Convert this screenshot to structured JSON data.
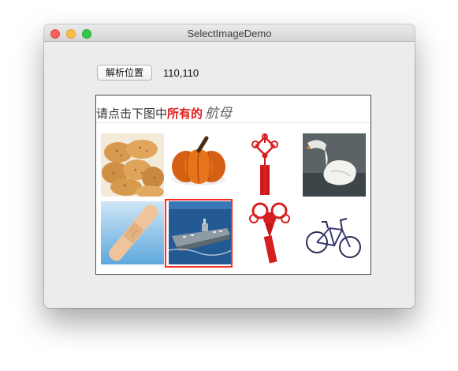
{
  "window": {
    "title": "SelectImageDemo"
  },
  "controls": {
    "parse_button_label": "解析位置",
    "position_value": "110,110"
  },
  "captcha": {
    "prompt_prefix": "请点击下图中",
    "prompt_highlight": "所有的",
    "prompt_target": "航母",
    "selected_index": 5,
    "images": [
      {
        "icon": "bread-image"
      },
      {
        "icon": "pumpkin-image"
      },
      {
        "icon": "chinese-knot-image"
      },
      {
        "icon": "swan-image"
      },
      {
        "icon": "bandage-image"
      },
      {
        "icon": "aircraft-carrier-image"
      },
      {
        "icon": "chinese-knot-image"
      },
      {
        "icon": "bicycle-image"
      }
    ]
  },
  "colors": {
    "highlight": "#e21b1b",
    "selection": "#ff2a20",
    "close": "#fc605c",
    "minimize": "#fdbc40",
    "maximize": "#34c84a"
  }
}
